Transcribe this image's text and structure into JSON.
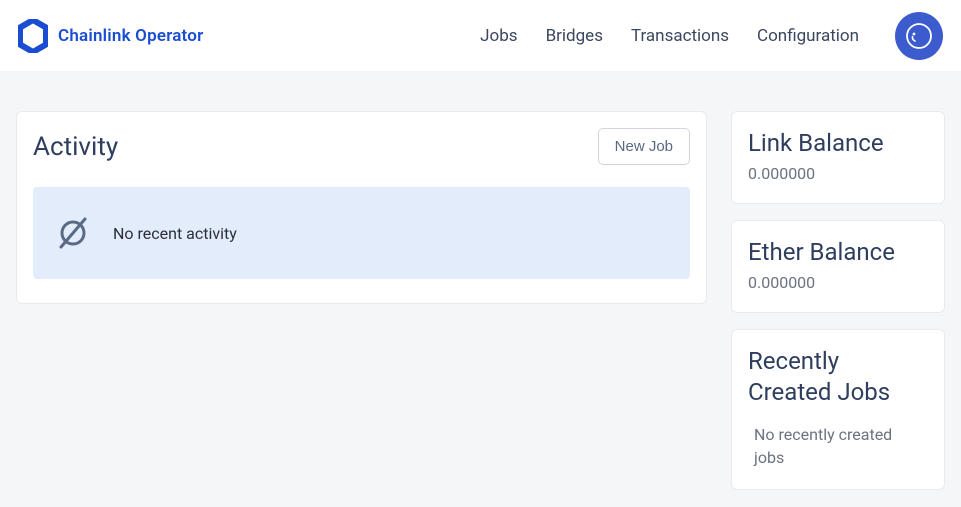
{
  "header": {
    "brand": "Chainlink Operator",
    "nav": {
      "jobs": "Jobs",
      "bridges": "Bridges",
      "transactions": "Transactions",
      "configuration": "Configuration"
    }
  },
  "activity": {
    "title": "Activity",
    "new_job_label": "New Job",
    "empty_text": "No recent activity"
  },
  "sidebar": {
    "link_balance": {
      "title": "Link Balance",
      "value": "0.000000"
    },
    "ether_balance": {
      "title": "Ether Balance",
      "value": "0.000000"
    },
    "recent_jobs": {
      "title": "Recently Created Jobs",
      "empty_text": "No recently created jobs"
    }
  }
}
